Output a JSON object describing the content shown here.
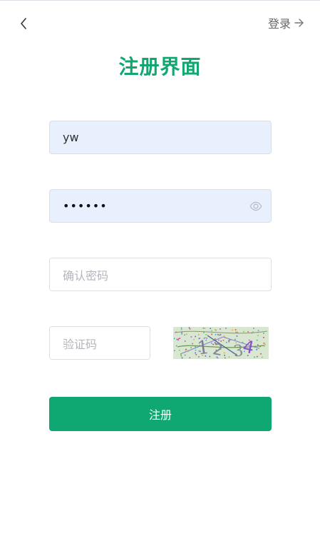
{
  "header": {
    "login_label": "登录",
    "back_icon": "chevron-left-icon",
    "arrow_icon": "arrow-right-icon"
  },
  "title": "注册界面",
  "form": {
    "username": {
      "value": "yw"
    },
    "password": {
      "value": "••••••",
      "toggle_icon": "eye-icon"
    },
    "confirm_password": {
      "placeholder": "确认密码"
    },
    "captcha": {
      "placeholder": "验证码",
      "image_text": "1234"
    },
    "submit_label": "注册"
  },
  "colors": {
    "accent": "#10a872",
    "filled_input_bg": "#e8effd",
    "captcha_bg": "#d9e6d1"
  }
}
